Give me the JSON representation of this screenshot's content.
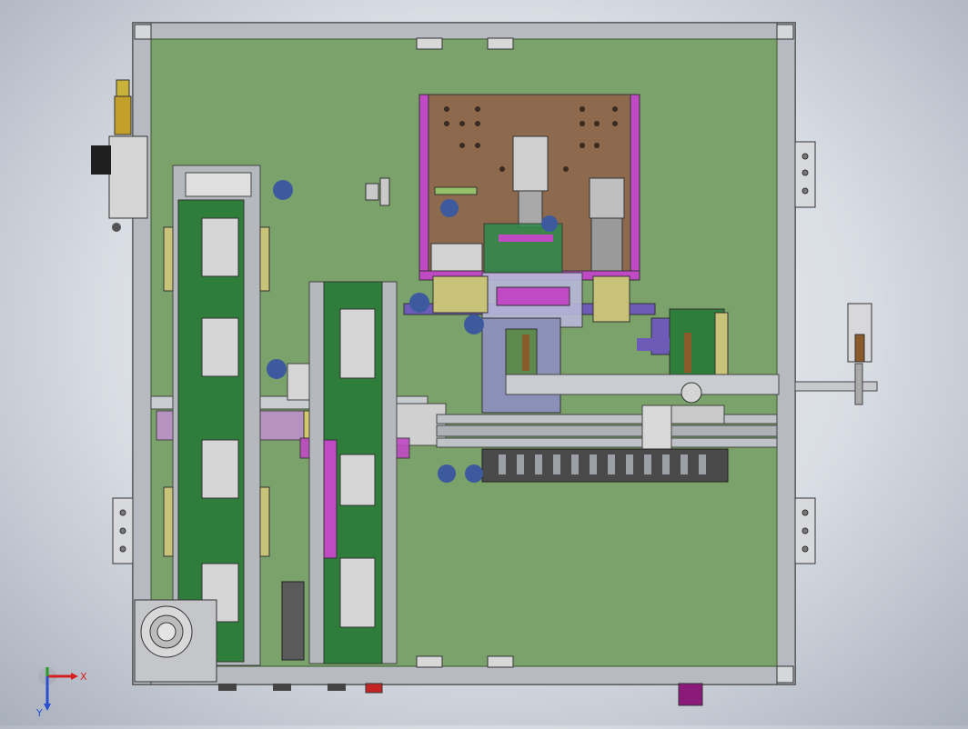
{
  "view": {
    "type": "cad-top-view",
    "background": "#dde1e8",
    "colors": {
      "plate": "#7aa26a",
      "frame": "#b9bcc2",
      "brown_panel": "#8d6a4e",
      "magenta": "#c04ac4",
      "purple": "#6e5bb8",
      "blue_dot": "#3d5a9e",
      "dark_green": "#2f7d3a"
    }
  },
  "triad": {
    "x_label": "X",
    "y_label": "Y",
    "x_color": "#d62020",
    "y_color": "#2a4fd0",
    "z_color": "#2a9a2a"
  }
}
